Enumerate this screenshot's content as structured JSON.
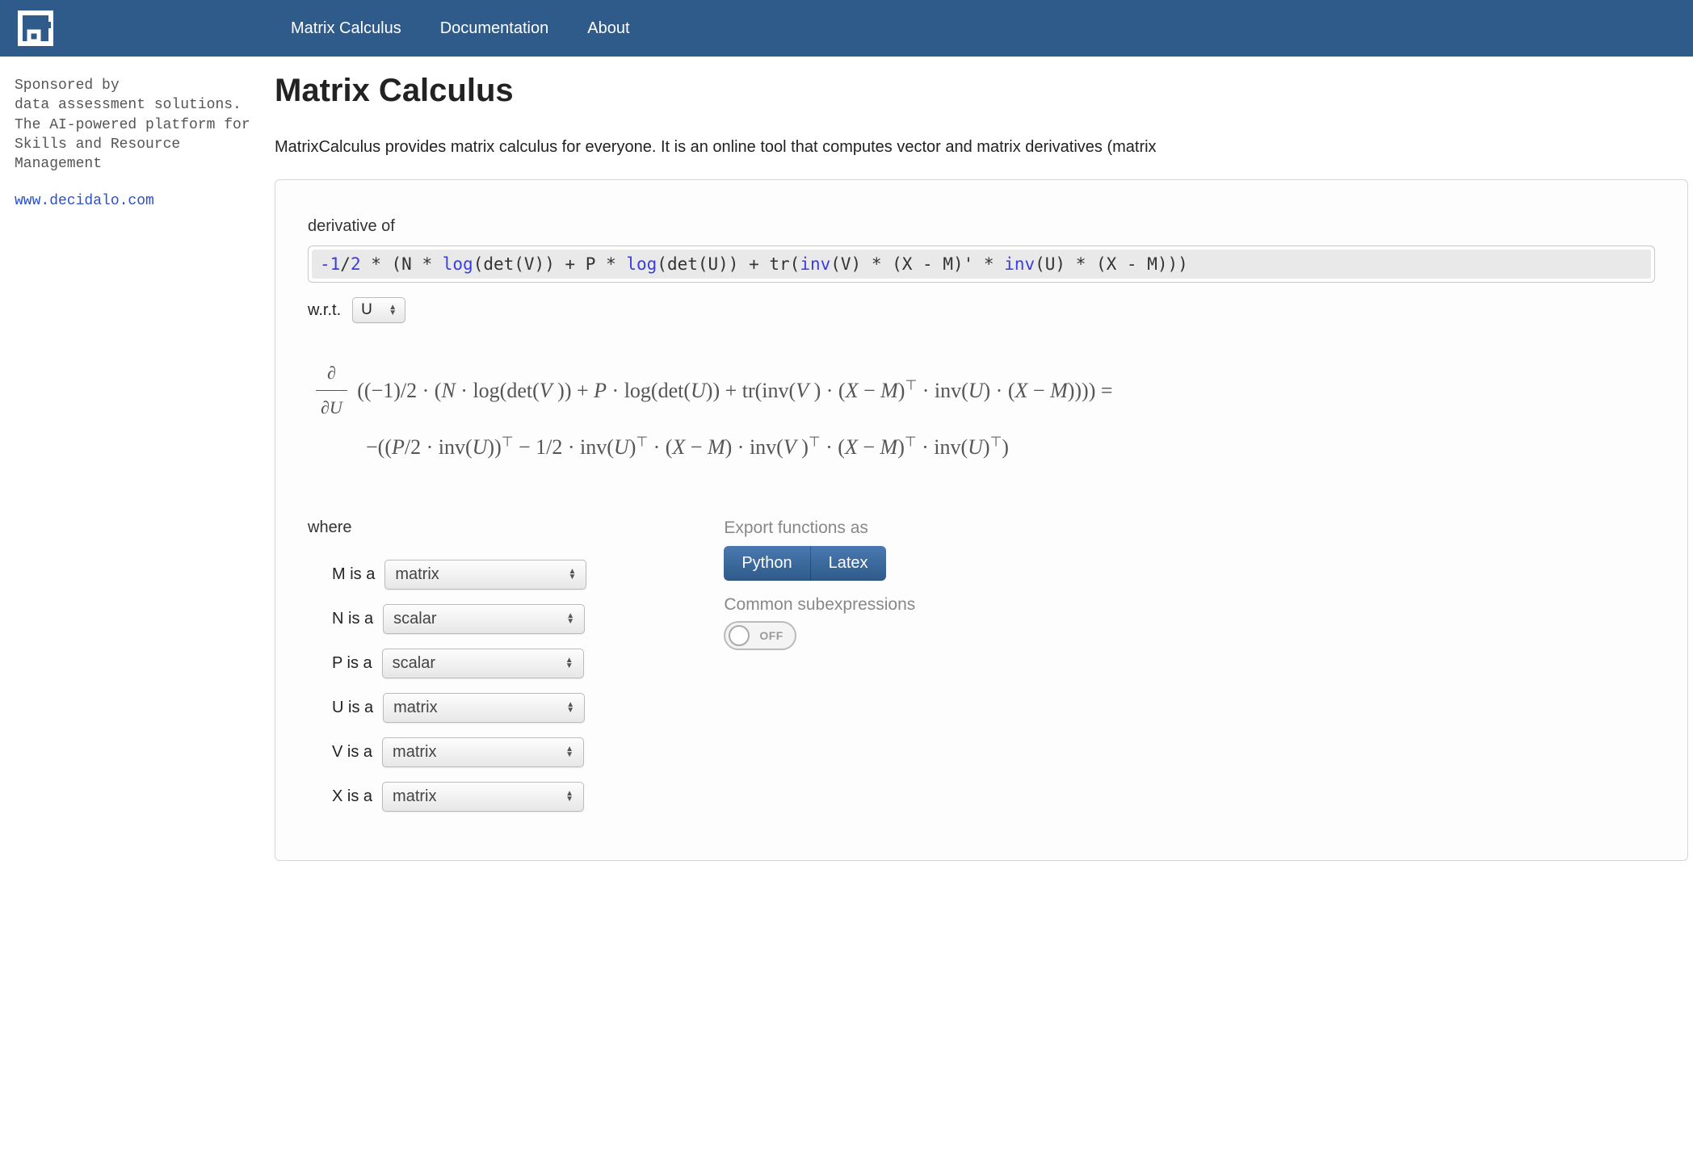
{
  "header": {
    "nav": [
      "Matrix Calculus",
      "Documentation",
      "About"
    ]
  },
  "sidebar": {
    "line1": "Sponsored by",
    "line2": "data assessment solutions.",
    "line3": "The AI-powered platform for",
    "line4": "Skills and Resource Management",
    "link": "www.decidalo.com"
  },
  "main": {
    "title": "Matrix Calculus",
    "intro": "MatrixCalculus provides matrix calculus for everyone. It is an online tool that computes vector and matrix derivatives (matrix",
    "derivative_label": "derivative of",
    "expression_tokens": [
      {
        "t": "-1",
        "c": "num"
      },
      {
        "t": "/"
      },
      {
        "t": "2",
        "c": "num"
      },
      {
        "t": " * (N * "
      },
      {
        "t": "log",
        "c": "fn"
      },
      {
        "t": "(det(V)) + P * "
      },
      {
        "t": "log",
        "c": "fn"
      },
      {
        "t": "(det(U)) + tr("
      },
      {
        "t": "inv",
        "c": "fn"
      },
      {
        "t": "(V) * (X - M)' * "
      },
      {
        "t": "inv",
        "c": "fn"
      },
      {
        "t": "(U) * (X - M)))"
      }
    ],
    "wrt_label": "w.r.t.",
    "wrt_value": "U",
    "result_line1": "((−1)/2 · (N · log(det(V )) + P · log(det(U)) + tr(inv(V ) · (X − M)⊤ · inv(U) · (X − M)))) =",
    "result_line2": "−((P/2 · inv(U))⊤ − 1/2 · inv(U)⊤ · (X − M) · inv(V )⊤ · (X − M)⊤ · inv(U)⊤)",
    "where_label": "where",
    "vars": [
      {
        "name": "M",
        "type": "matrix"
      },
      {
        "name": "N",
        "type": "scalar"
      },
      {
        "name": "P",
        "type": "scalar"
      },
      {
        "name": "U",
        "type": "matrix"
      },
      {
        "name": "V",
        "type": "matrix"
      },
      {
        "name": "X",
        "type": "matrix"
      }
    ],
    "export_label": "Export functions as",
    "export_buttons": [
      "Python",
      "Latex"
    ],
    "cse_label": "Common subexpressions",
    "cse_state": "OFF"
  }
}
